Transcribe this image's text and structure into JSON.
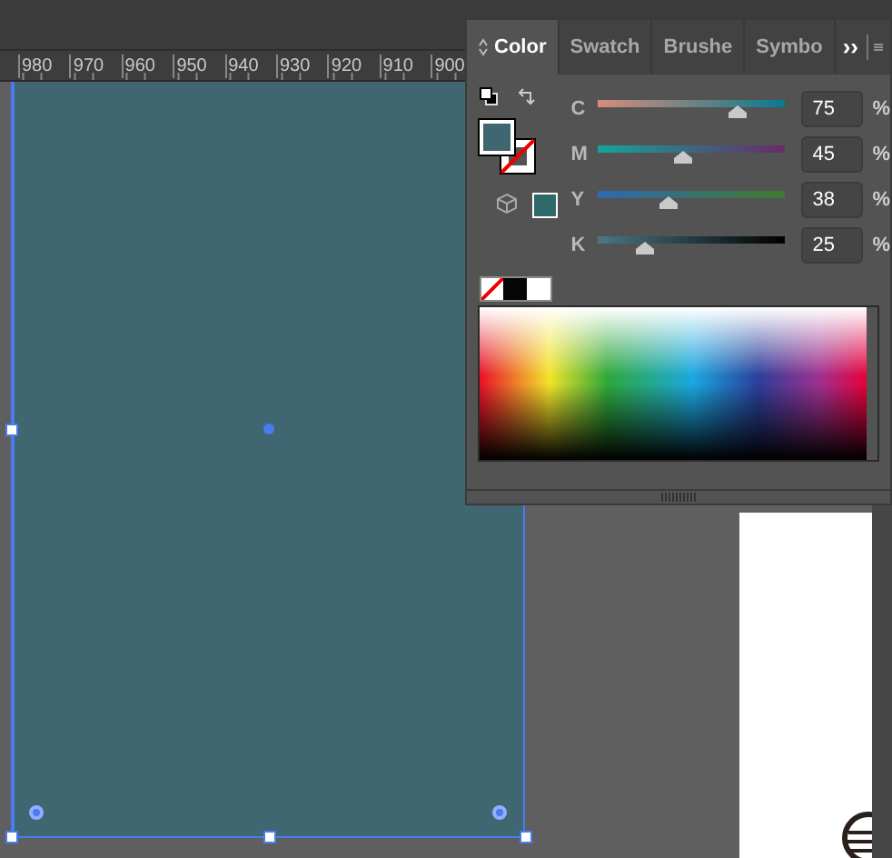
{
  "ruler": {
    "labels": [
      "980",
      "970",
      "960",
      "950",
      "940",
      "930",
      "920",
      "910",
      "900"
    ]
  },
  "panel": {
    "tabs": [
      {
        "label": "Color",
        "selected": true
      },
      {
        "label": "Swatch",
        "selected": false
      },
      {
        "label": "Brushe",
        "selected": false
      },
      {
        "label": "Symbo",
        "selected": false
      }
    ],
    "overflow": "››",
    "sliders": [
      {
        "name": "C",
        "value": "75",
        "unit": "%",
        "level": 0.75
      },
      {
        "name": "M",
        "value": "45",
        "unit": "%",
        "level": 0.45
      },
      {
        "name": "Y",
        "value": "38",
        "unit": "%",
        "level": 0.38
      },
      {
        "name": "K",
        "value": "25",
        "unit": "%",
        "level": 0.25
      }
    ]
  }
}
